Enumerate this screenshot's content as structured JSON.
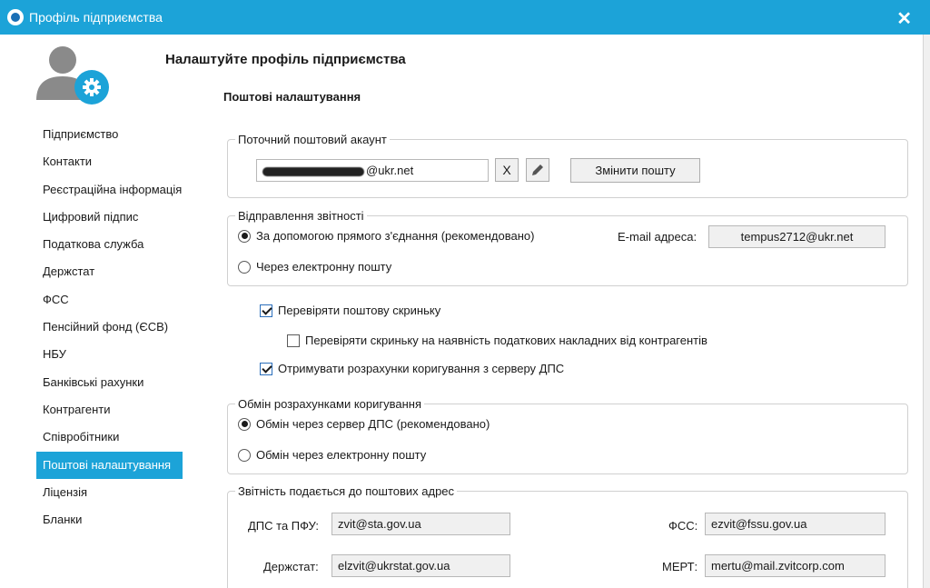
{
  "window": {
    "title": "Профіль підприємства",
    "close_glyph": "✕"
  },
  "heading": "Налаштуйте профіль підприємства",
  "subheading": "Поштові налаштування",
  "nav": {
    "items": [
      {
        "label": "Підприємство"
      },
      {
        "label": "Контакти"
      },
      {
        "label": "Реєстраційна інформація"
      },
      {
        "label": "Цифровий підпис"
      },
      {
        "label": "Податкова служба"
      },
      {
        "label": "Держстат"
      },
      {
        "label": "ФСС"
      },
      {
        "label": "Пенсійний фонд (ЄСВ)"
      },
      {
        "label": "НБУ"
      },
      {
        "label": "Банківські рахунки"
      },
      {
        "label": "Контрагенти"
      },
      {
        "label": "Співробітники"
      },
      {
        "label": "Поштові налаштування"
      },
      {
        "label": "Ліцензія"
      },
      {
        "label": "Бланки"
      }
    ],
    "active_index": 12
  },
  "account": {
    "legend": "Поточний поштовий акаунт",
    "email_suffix": "@ukr.net",
    "clear_glyph": "X",
    "change_button": "Змінити пошту",
    "icons": {
      "clear": "clear-icon",
      "edit": "pencil-icon"
    }
  },
  "sending": {
    "legend": "Відправлення звітності",
    "option_direct": "За допомогою прямого з'єднання (рекомендовано)",
    "option_email": "Через електронну пошту",
    "selected": "direct",
    "email_label": "E-mail адреса:",
    "email_value": "tempus2712@ukr.net"
  },
  "checks": {
    "check_mailbox": "Перевіряти поштову скриньку",
    "check_invoices": "Перевіряти скриньку на наявність податкових накладних від контрагентів",
    "receive_corrections": "Отримувати розрахунки коригування з серверу ДПС",
    "states": {
      "check_mailbox": true,
      "check_invoices": false,
      "receive_corrections": true
    }
  },
  "exchange": {
    "legend": "Обмін розрахунками коригування",
    "option_server": "Обмін через сервер ДПС (рекомендовано)",
    "option_email": "Обмін через електронну пошту",
    "selected": "server"
  },
  "addresses": {
    "legend": "Звітність подається до поштових адрес",
    "dps_label": "ДПС та ПФУ:",
    "dps_value": "zvit@sta.gov.ua",
    "fss_label": "ФСС:",
    "fss_value": "ezvit@fssu.gov.ua",
    "derzhstat_label": "Держстат:",
    "derzhstat_value": "elzvit@ukrstat.gov.ua",
    "mert_label": "МЕРТ:",
    "mert_value": "mertu@mail.zvitcorp.com"
  },
  "colors": {
    "accent": "#1ca3d8",
    "avatar_grey": "#8a8a8a",
    "gear_blue": "#1ca3d8"
  }
}
